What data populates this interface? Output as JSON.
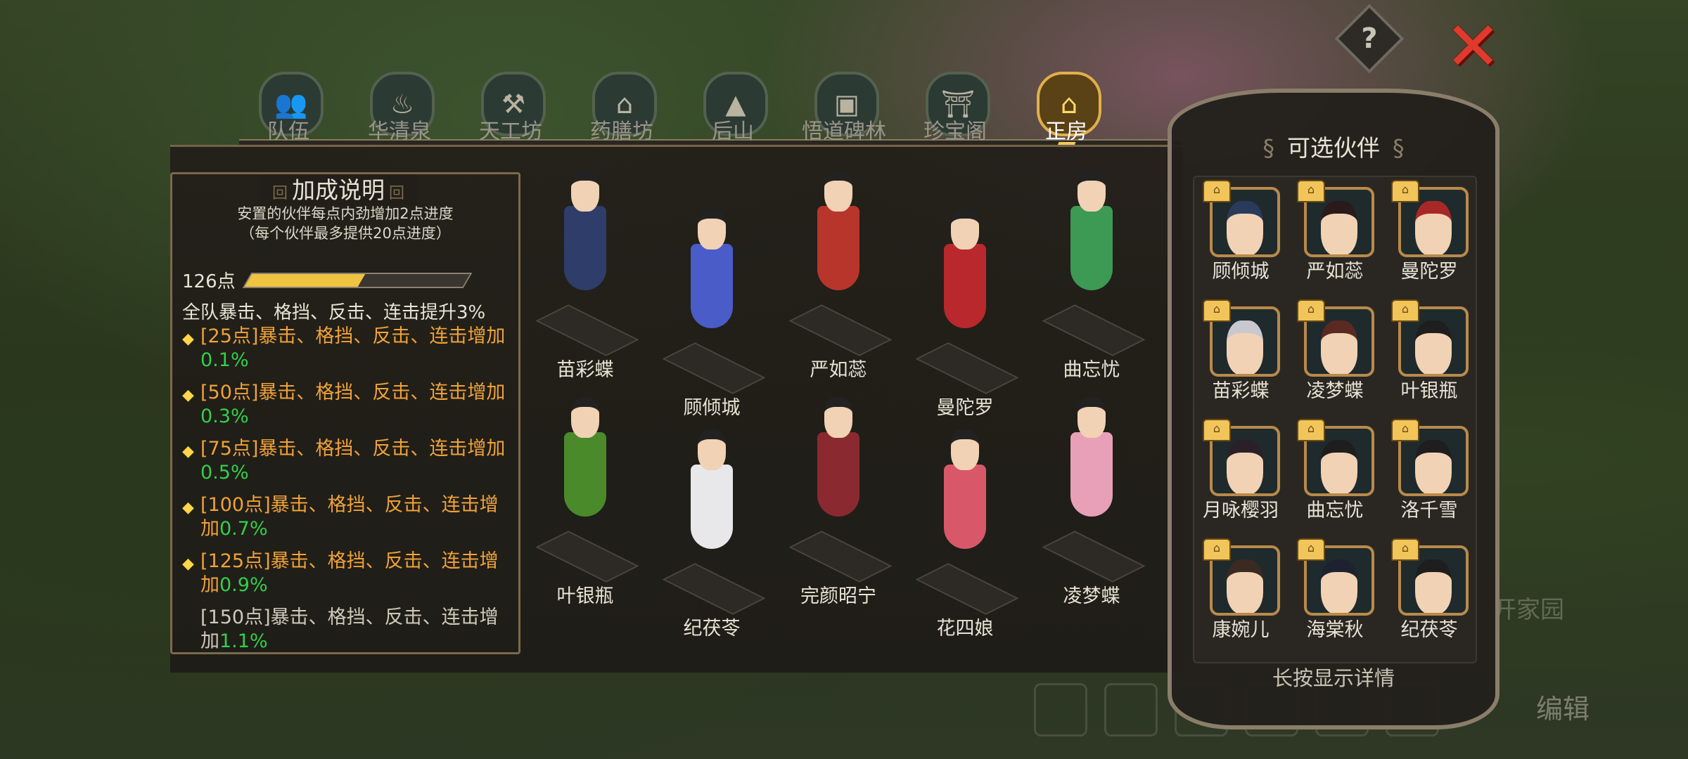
{
  "top_buttons": {
    "help_icon": "question-mark",
    "help_glyph": "?",
    "close_icon": "red-x",
    "close_glyph": "✕"
  },
  "tabs": [
    {
      "label": "队伍",
      "icon": "team-icon",
      "glyph": "👥",
      "active": false
    },
    {
      "label": "华清泉",
      "icon": "spring-icon",
      "glyph": "♨",
      "active": false
    },
    {
      "label": "天工坊",
      "icon": "workshop-icon",
      "glyph": "⚒",
      "active": false
    },
    {
      "label": "药膳坊",
      "icon": "kitchen-icon",
      "glyph": "⌂",
      "active": false
    },
    {
      "label": "后山",
      "icon": "mountain-icon",
      "glyph": "▲",
      "active": false
    },
    {
      "label": "悟道碑林",
      "icon": "stele-icon",
      "glyph": "▣",
      "active": false
    },
    {
      "label": "珍宝阁",
      "icon": "pagoda-icon",
      "glyph": "⛩",
      "active": false
    },
    {
      "label": "正房",
      "icon": "main-hall-icon",
      "glyph": "⌂",
      "active": true
    }
  ],
  "bonus": {
    "title": "加成说明",
    "desc_line1": "安置的伙伴每点内劲增加2点进度",
    "desc_line2": "（每个伙伴最多提供20点进度）",
    "points_label": "126点",
    "progress_fraction": 0.52,
    "team_bonus": "全队暴击、格挡、反击、连击提升3%",
    "tiers": [
      {
        "text": "[25点]暴击、格挡、反击、连击增加",
        "value": "0.1%",
        "reached": true
      },
      {
        "text": "[50点]暴击、格挡、反击、连击增加",
        "value": "0.3%",
        "reached": true
      },
      {
        "text": "[75点]暴击、格挡、反击、连击增加",
        "value": "0.5%",
        "reached": true
      },
      {
        "text": "[100点]暴击、格挡、反击、连击增加",
        "value": "0.7%",
        "reached": true
      },
      {
        "text": "[125点]暴击、格挡、反击、连击增加",
        "value": "0.9%",
        "reached": true
      },
      {
        "text": "[150点]暴击、格挡、反击、连击增加",
        "value": "1.1%",
        "reached": false
      }
    ],
    "colors": {
      "reached": "#f0a238",
      "value": "#31d04a",
      "locked": "#cfc9ba"
    }
  },
  "placed_characters": [
    {
      "name": "苗彩蝶",
      "color": "#2f3d6a"
    },
    {
      "name": "顾倾城",
      "color": "#4a5cc8"
    },
    {
      "name": "严如蕊",
      "color": "#b8352c"
    },
    {
      "name": "曼陀罗",
      "color": "#b8282c"
    },
    {
      "name": "曲忘忧",
      "color": "#3c9a54"
    },
    {
      "name": "叶银瓶",
      "color": "#4a8a2a"
    },
    {
      "name": "纪茯苓",
      "color": "#e8e8ea"
    },
    {
      "name": "完颜昭宁",
      "color": "#8a2a30"
    },
    {
      "name": "花四娘",
      "color": "#d8586a"
    },
    {
      "name": "凌梦蝶",
      "color": "#e8a0b8"
    }
  ],
  "partners": {
    "title": "可选伙伴",
    "hint": "长按显示详情",
    "items": [
      {
        "name": "顾倾城",
        "hair": "#2a3a5a"
      },
      {
        "name": "严如蕊",
        "hair": "#2a1a1a"
      },
      {
        "name": "曼陀罗",
        "hair": "#a82828"
      },
      {
        "name": "苗彩蝶",
        "hair": "#c8c8d0"
      },
      {
        "name": "凌梦蝶",
        "hair": "#5a2a22"
      },
      {
        "name": "叶银瓶",
        "hair": "#1e1e1e"
      },
      {
        "name": "月咏樱羽",
        "hair": "#2a2028"
      },
      {
        "name": "曲忘忧",
        "hair": "#1e1e1e"
      },
      {
        "name": "洛千雪",
        "hair": "#1e1e1e"
      },
      {
        "name": "康婉儿",
        "hair": "#3a2a22"
      },
      {
        "name": "海棠秋",
        "hair": "#1e2230"
      },
      {
        "name": "纪茯苓",
        "hair": "#1e1e1e"
      }
    ]
  },
  "background": {
    "home_text": "开家园",
    "edit_text": "编辑"
  }
}
